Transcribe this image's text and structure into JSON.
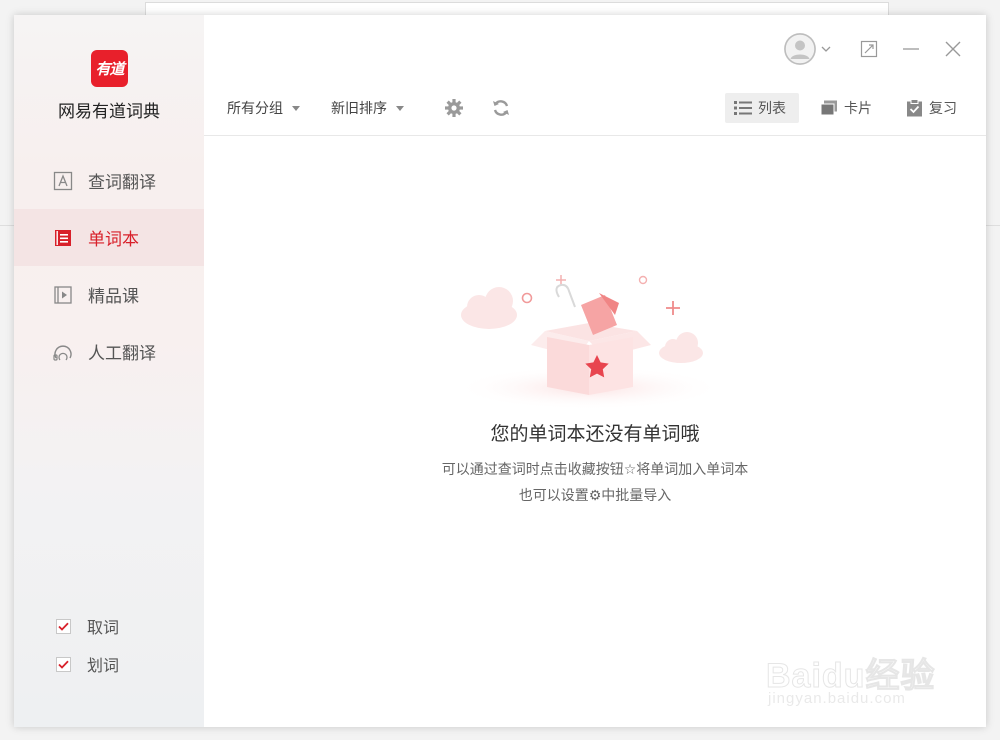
{
  "app": {
    "logo_text": "有道",
    "name": "网易有道词典"
  },
  "sidebar": {
    "items": [
      {
        "label": "查词翻译",
        "icon": "dictionary-icon",
        "active": false
      },
      {
        "label": "单词本",
        "icon": "wordbook-icon",
        "active": true
      },
      {
        "label": "精品课",
        "icon": "course-play-icon",
        "active": false
      },
      {
        "label": "人工翻译",
        "icon": "human-translate-icon",
        "active": false
      }
    ],
    "options": [
      {
        "label": "取词",
        "checked": true
      },
      {
        "label": "划词",
        "checked": true
      }
    ]
  },
  "toolbar": {
    "group_filter": "所有分组",
    "sort_order": "新旧排序",
    "settings_icon": "gear-icon",
    "sync_icon": "refresh-icon",
    "views": [
      {
        "label": "列表",
        "icon": "list-icon",
        "active": true
      },
      {
        "label": "卡片",
        "icon": "cards-icon",
        "active": false
      },
      {
        "label": "复习",
        "icon": "review-icon",
        "active": false
      }
    ]
  },
  "empty_state": {
    "title": "您的单词本还没有单词哦",
    "line1": "可以通过查词时点击收藏按钮☆将单词加入单词本",
    "line2": "也可以设置⚙中批量导入"
  },
  "watermark": {
    "text": "Baidu经验",
    "sub": "jingyan.baidu.com"
  },
  "colors": {
    "accent": "#e8202b",
    "active_bg": "#f4e4e4"
  }
}
